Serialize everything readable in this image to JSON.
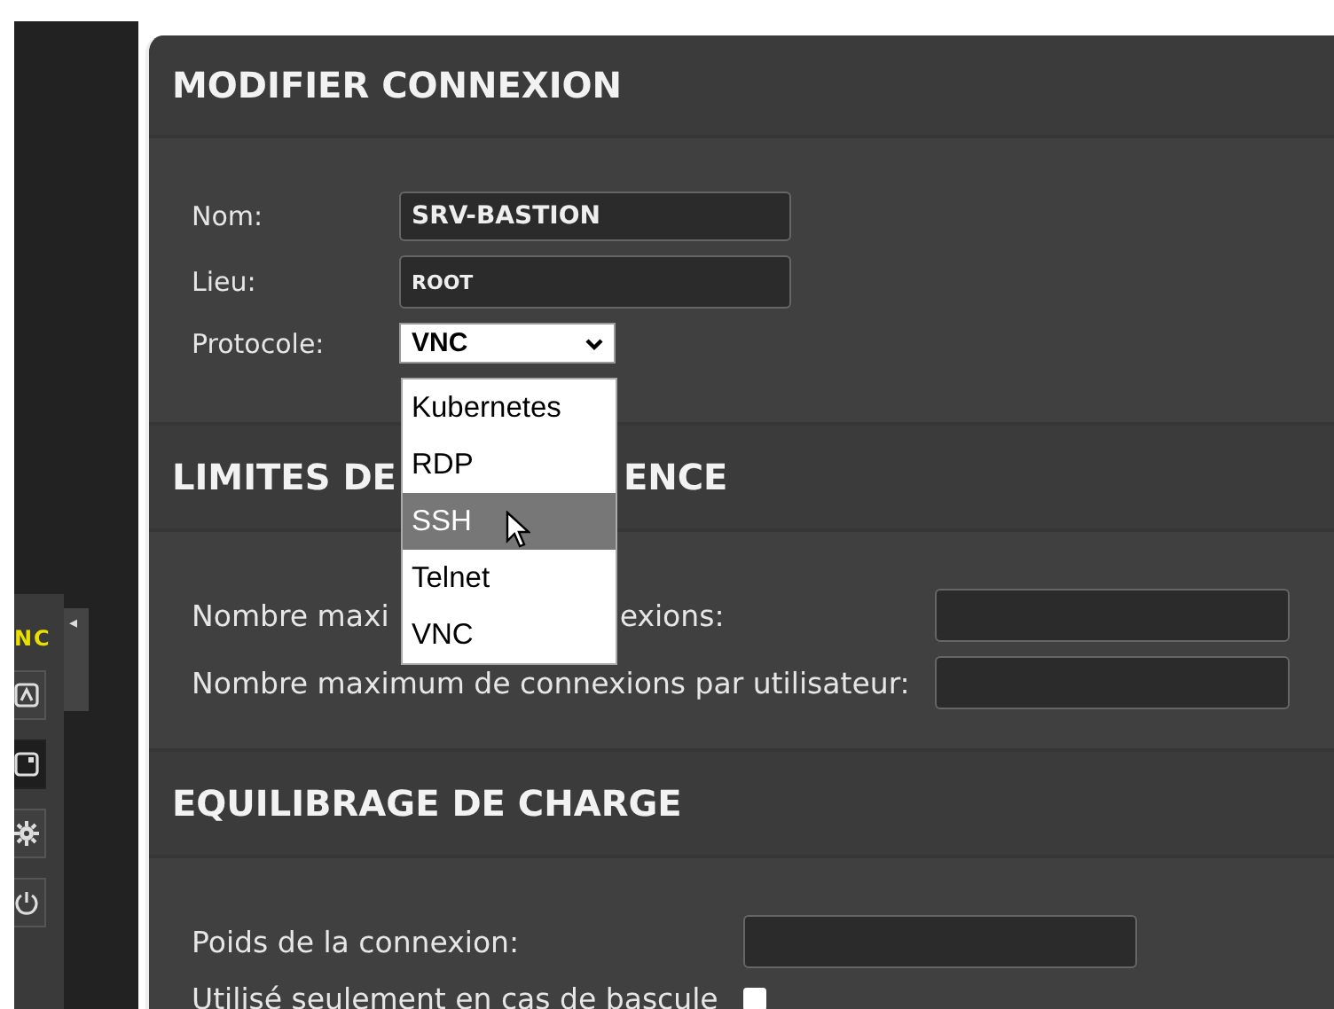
{
  "sidebar": {
    "logo_text": "NC",
    "collapse_arrow": "◂",
    "buttons": [
      {
        "kind": "chart",
        "selected": false
      },
      {
        "kind": "window",
        "selected": true
      },
      {
        "kind": "gear",
        "selected": false
      },
      {
        "kind": "power",
        "selected": false
      }
    ]
  },
  "dialog": {
    "title": "MODIFIER CONNEXION",
    "fields": [
      {
        "label": "Nom:",
        "value": "SRV-BASTION",
        "kind": "large"
      },
      {
        "label": "Lieu:",
        "value": "ROOT",
        "kind": "small"
      }
    ],
    "protocol": {
      "label": "Protocole:",
      "value": "VNC"
    },
    "dropdown": {
      "options": [
        {
          "label": "Kubernetes",
          "highlighted": false
        },
        {
          "label": "RDP",
          "highlighted": false
        },
        {
          "label": "SSH",
          "highlighted": true
        },
        {
          "label": "Telnet",
          "highlighted": false
        },
        {
          "label": "VNC",
          "highlighted": false
        }
      ]
    },
    "sections": [
      {
        "heading_parts": [
          "LIMITES DE",
          "ENCE"
        ],
        "fields": [
          {
            "kind": "text",
            "label_parts": [
              "Nombre maxi",
              "exions:"
            ]
          },
          {
            "kind": "text",
            "label_parts": [
              "Nombre maximum de connexions par utilisateur:"
            ]
          }
        ]
      },
      {
        "heading_parts": [
          "EQUILIBRAGE DE CHARGE"
        ],
        "fields": [
          {
            "kind": "narrow",
            "label_parts": [
              "Poids de la connexion:"
            ]
          },
          {
            "kind": "checkbox",
            "label_parts": [
              "Utilisé seulement en cas de bascule"
            ],
            "checked": false
          }
        ]
      }
    ]
  }
}
